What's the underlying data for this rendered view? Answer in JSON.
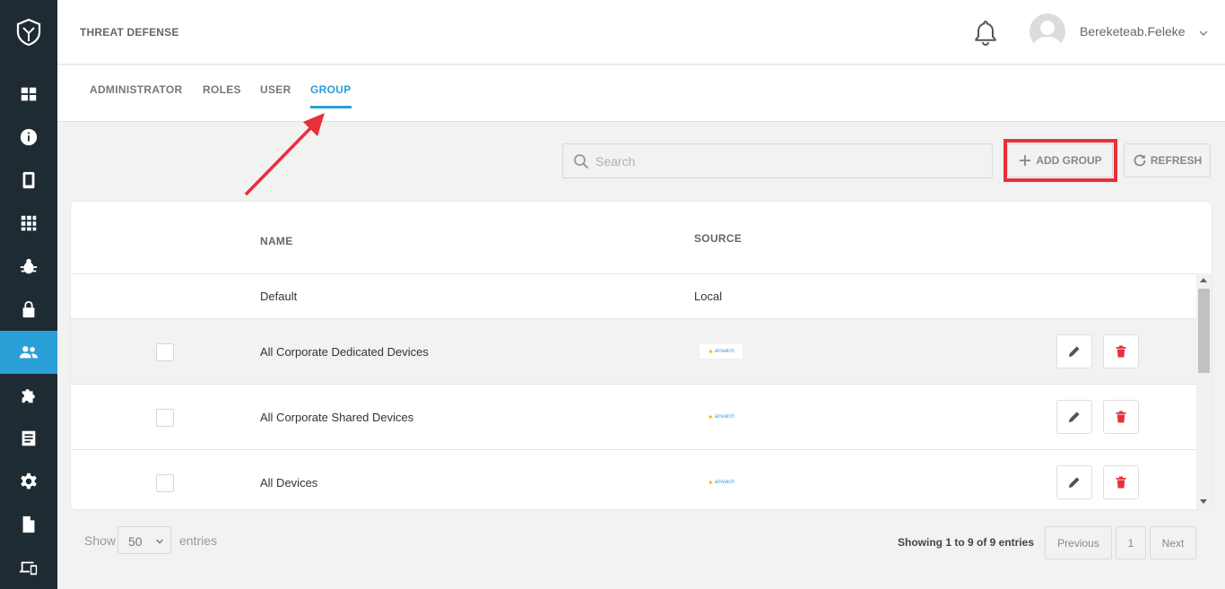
{
  "header": {
    "app_title": "THREAT DEFENSE",
    "username": "Bereketeab.Feleke"
  },
  "tabs": [
    {
      "label": "ADMINISTRATOR",
      "active": false
    },
    {
      "label": "ROLES",
      "active": false
    },
    {
      "label": "USER",
      "active": false
    },
    {
      "label": "GROUP",
      "active": true
    }
  ],
  "sidebar": {
    "items": [
      {
        "icon": "dashboard-icon"
      },
      {
        "icon": "info-icon"
      },
      {
        "icon": "mobile-device-icon"
      },
      {
        "icon": "apps-grid-icon"
      },
      {
        "icon": "bug-icon"
      },
      {
        "icon": "lock-icon"
      },
      {
        "icon": "users-icon",
        "active": true
      },
      {
        "icon": "puzzle-icon"
      },
      {
        "icon": "document-list-icon"
      },
      {
        "icon": "gear-icon"
      },
      {
        "icon": "file-icon"
      },
      {
        "icon": "devices-icon"
      }
    ]
  },
  "toolbar": {
    "search_placeholder": "Search",
    "add_group_label": "ADD GROUP",
    "refresh_label": "REFRESH"
  },
  "table": {
    "columns": [
      "NAME",
      "SOURCE"
    ],
    "rows": [
      {
        "name": "Default",
        "source": "Local",
        "selectable": false
      },
      {
        "name": "All Corporate Dedicated Devices",
        "source_logo": "airwatch",
        "selectable": true
      },
      {
        "name": "All Corporate Shared Devices",
        "source_logo": "airwatch",
        "selectable": true
      },
      {
        "name": "All Devices",
        "source_logo": "airwatch",
        "selectable": true
      }
    ],
    "logo_text": "airwatch"
  },
  "footer": {
    "show_label": "Show",
    "page_size": "50",
    "entries_label": "entries",
    "info": "Showing 1 to 9 of 9 entries",
    "previous_label": "Previous",
    "current_page": "1",
    "next_label": "Next"
  },
  "colors": {
    "sidebar_bg": "#1f2b33",
    "accent": "#2a9fd8",
    "delete_red": "#e8303a",
    "annotation_red": "#e8303a"
  }
}
